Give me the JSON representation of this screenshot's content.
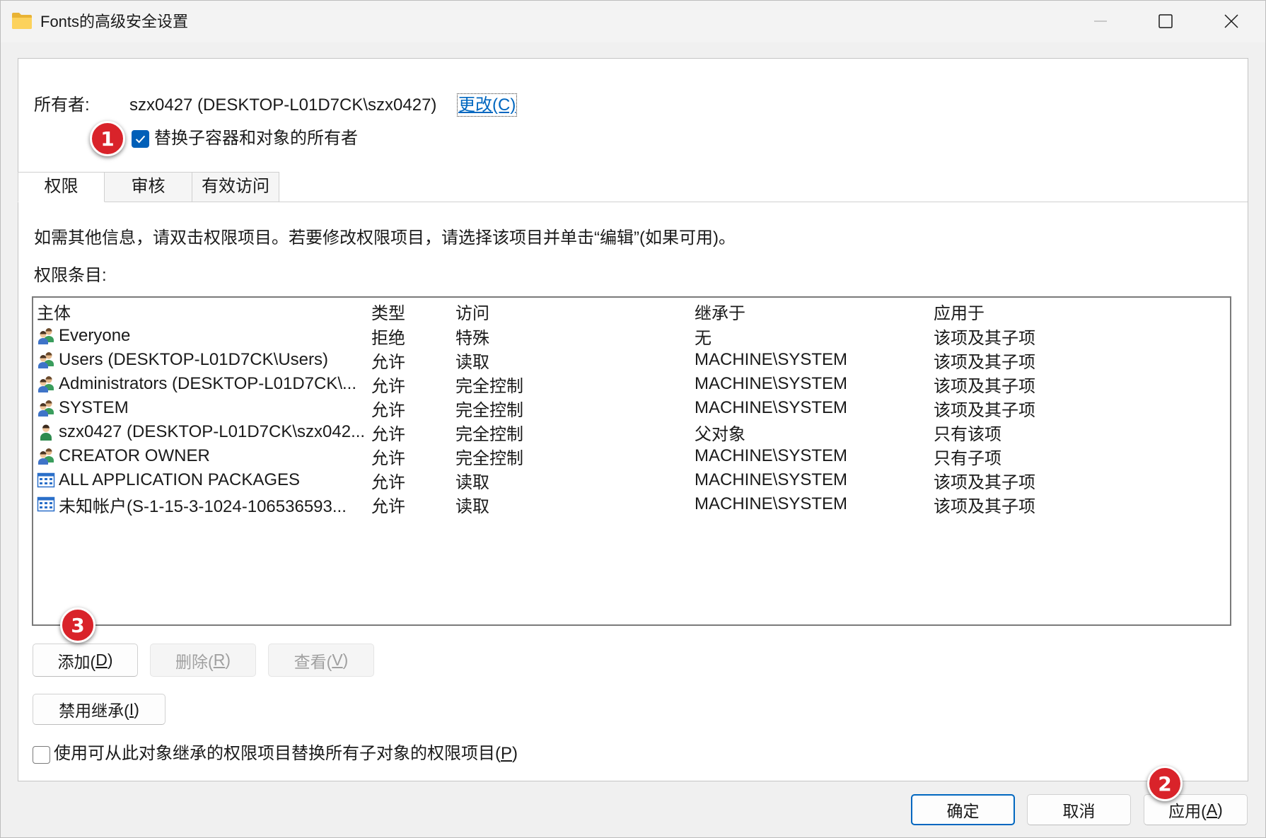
{
  "window": {
    "title": "Fonts的高级安全设置",
    "icon": "folder-icon"
  },
  "owner": {
    "label": "所有者:",
    "value": "szx0427 (DESKTOP-L01D7CK\\szx0427)",
    "change_link": "更改(C)"
  },
  "replace_owner_checkbox": {
    "label": "替换子容器和对象的所有者",
    "checked": true
  },
  "tabs": [
    {
      "label": "权限",
      "selected": true
    },
    {
      "label": "审核",
      "selected": false
    },
    {
      "label": "有效访问",
      "selected": false
    }
  ],
  "permissions": {
    "info_text": "如需其他信息，请双击权限项目。若要修改权限项目，请选择该项目并单击“编辑”(如果可用)。",
    "entries_label": "权限条目:",
    "columns": [
      "主体",
      "类型",
      "访问",
      "继承于",
      "应用于"
    ],
    "rows": [
      {
        "icon": "group-icon",
        "principal": "Everyone",
        "type": "拒绝",
        "access": "特殊",
        "inherited_from": "无",
        "applies_to": "该项及其子项"
      },
      {
        "icon": "group-icon",
        "principal": "Users (DESKTOP-L01D7CK\\Users)",
        "type": "允许",
        "access": "读取",
        "inherited_from": "MACHINE\\SYSTEM",
        "applies_to": "该项及其子项"
      },
      {
        "icon": "group-icon",
        "principal": "Administrators (DESKTOP-L01D7CK\\...",
        "type": "允许",
        "access": "完全控制",
        "inherited_from": "MACHINE\\SYSTEM",
        "applies_to": "该项及其子项"
      },
      {
        "icon": "group-icon",
        "principal": "SYSTEM",
        "type": "允许",
        "access": "完全控制",
        "inherited_from": "MACHINE\\SYSTEM",
        "applies_to": "该项及其子项"
      },
      {
        "icon": "user-icon",
        "principal": "szx0427 (DESKTOP-L01D7CK\\szx042...",
        "type": "允许",
        "access": "完全控制",
        "inherited_from": "父对象",
        "applies_to": "只有该项"
      },
      {
        "icon": "group-icon",
        "principal": "CREATOR OWNER",
        "type": "允许",
        "access": "完全控制",
        "inherited_from": "MACHINE\\SYSTEM",
        "applies_to": "只有子项"
      },
      {
        "icon": "app-package-icon",
        "principal": "ALL APPLICATION PACKAGES",
        "type": "允许",
        "access": "读取",
        "inherited_from": "MACHINE\\SYSTEM",
        "applies_to": "该项及其子项"
      },
      {
        "icon": "app-package-icon",
        "principal": "未知帐户(S-1-15-3-1024-106536593...",
        "type": "允许",
        "access": "读取",
        "inherited_from": "MACHINE\\SYSTEM",
        "applies_to": "该项及其子项"
      }
    ]
  },
  "entry_buttons": {
    "add": {
      "label": "添加(D)",
      "enabled": true
    },
    "remove": {
      "label": "删除(R)",
      "enabled": false
    },
    "view": {
      "label": "查看(V)",
      "enabled": false
    }
  },
  "disable_inheritance_button": {
    "label": "禁用继承(I)",
    "enabled": true
  },
  "replace_child_permissions_checkbox": {
    "label": "使用可从此对象继承的权限项目替换所有子对象的权限项目(P)",
    "checked": false
  },
  "dialog_buttons": {
    "ok": "确定",
    "cancel": "取消",
    "apply": "应用(A)"
  },
  "step_badges": {
    "replace_owner": "1",
    "apply": "2",
    "add": "3"
  },
  "colors": {
    "accent": "#005fb8",
    "link": "#0067c0",
    "badge": "#d9232a",
    "window_bg": "#f0f0f0",
    "panel_bg": "#ffffff"
  }
}
